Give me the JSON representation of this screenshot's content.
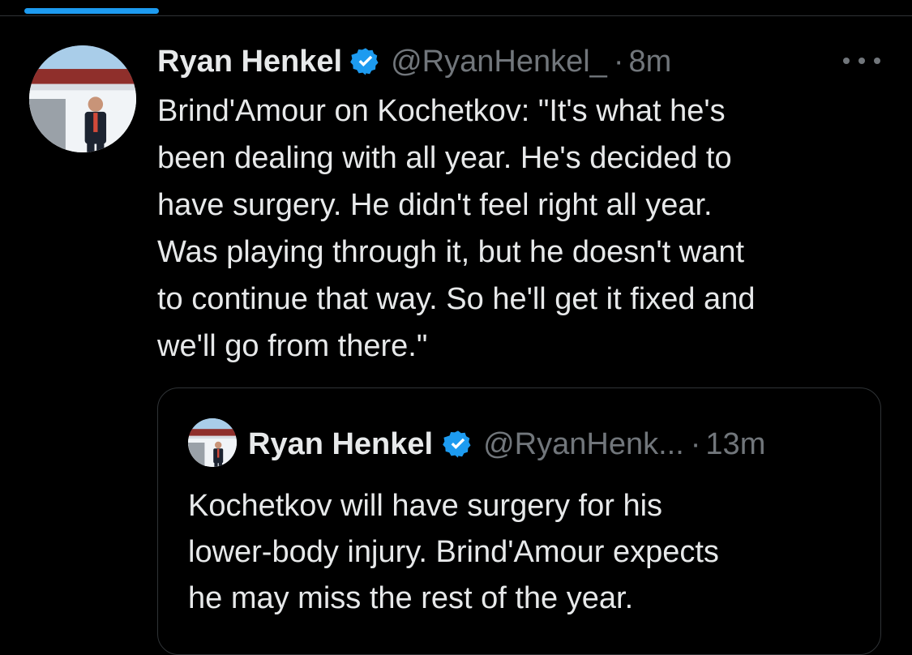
{
  "colors": {
    "accent": "#1d9bf0",
    "background": "#000000",
    "text": "#e7e9ea",
    "muted": "#71767b",
    "border": "#2f3336"
  },
  "tweet": {
    "display_name": "Ryan Henkel",
    "verified_icon": "verified-badge-icon",
    "handle": "@RyanHenkel_",
    "separator": "·",
    "time": "8m",
    "more_icon": "more-horizontal-icon",
    "text": "Brind'Amour on Kochetkov: \"It's what he's\nbeen dealing with all year. He's decided to\nhave surgery. He didn't feel right all year.\nWas playing through it, but he doesn't want\nto continue that way. So he'll get it fixed and\nwe'll go from there.\""
  },
  "quoted_tweet": {
    "display_name": "Ryan Henkel",
    "verified_icon": "verified-badge-icon",
    "handle": "@RyanHenk...",
    "separator": "·",
    "time": "13m",
    "text": "Kochetkov will have surgery for his\nlower-body injury. Brind'Amour expects\nhe may miss the rest of the year."
  }
}
